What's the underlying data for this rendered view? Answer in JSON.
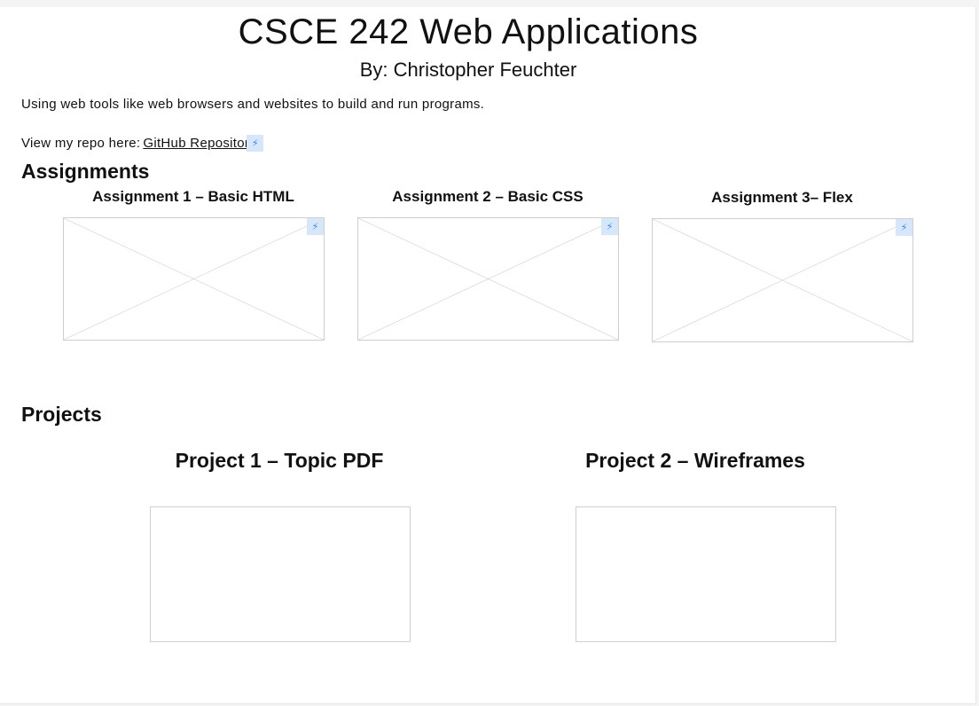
{
  "header": {
    "title": "CSCE 242 Web Applications",
    "byline": "By: Christopher Feuchter"
  },
  "intro": "Using web tools like web browsers and websites to build and run programs.",
  "repo": {
    "label": "View my repo here:",
    "link_text": "GitHub Repository"
  },
  "assignments": {
    "heading": "Assignments",
    "items": [
      {
        "title": "Assignment 1 – Basic HTML"
      },
      {
        "title": "Assignment 2 – Basic CSS"
      },
      {
        "title": "Assignment 3– Flex"
      }
    ]
  },
  "projects": {
    "heading": "Projects",
    "items": [
      {
        "title": "Project 1 – Topic PDF"
      },
      {
        "title": "Project 2 – Wireframes"
      }
    ]
  },
  "icons": {
    "bolt": "lightning-bolt-icon",
    "placeholder": "image-placeholder-icon"
  },
  "colors": {
    "badge_bg": "#d6e7fb",
    "badge_icon": "#3a84e8",
    "placeholder_border": "#cfcfcf"
  }
}
